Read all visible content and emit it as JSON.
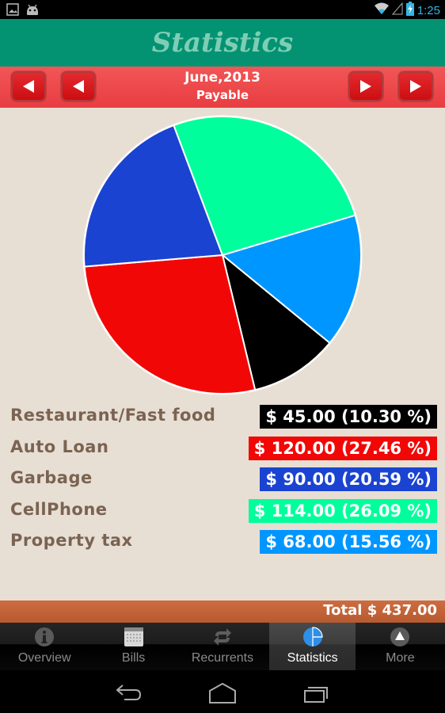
{
  "status_bar": {
    "time": "1:25",
    "icons": [
      "image-icon",
      "android-icon",
      "wifi-icon",
      "signal-icon",
      "battery-charging-icon"
    ]
  },
  "header": {
    "title": "Statistics"
  },
  "period_nav": {
    "month_label": "June,2013",
    "type_label": "Payable",
    "buttons": [
      "prev-year",
      "prev-month",
      "next-month",
      "next-year"
    ]
  },
  "colors": {
    "title_bar": "#039373",
    "nav_bar": "#ef4b4f",
    "total_bar": "#c4643a",
    "background": "#e8dfd4",
    "legend_text": "#7a6352",
    "active_tab_icon": "#2f8ee8"
  },
  "chart_data": {
    "type": "pie",
    "title": "",
    "start_angle_deg": -16.7,
    "direction": "clockwise",
    "slices": [
      {
        "label": "Property tax",
        "value": 68.0,
        "percent": 15.56,
        "color": "#0096ff"
      },
      {
        "label": "Restaurant/Fast food",
        "value": 45.0,
        "percent": 10.3,
        "color": "#000000"
      },
      {
        "label": "Auto Loan",
        "value": 120.0,
        "percent": 27.46,
        "color": "#f20707"
      },
      {
        "label": "Garbage",
        "value": 90.0,
        "percent": 20.59,
        "color": "#1a43d1"
      },
      {
        "label": "CellPhone",
        "value": 114.0,
        "percent": 26.09,
        "color": "#00ff9c"
      }
    ],
    "slice_border": "#ffffff"
  },
  "legend": [
    {
      "label": "Restaurant/Fast food",
      "value_text": "$ 45.00 (10.30 %)",
      "color": "#000000"
    },
    {
      "label": "Auto Loan",
      "value_text": "$ 120.00 (27.46 %)",
      "color": "#f20707"
    },
    {
      "label": "Garbage",
      "value_text": "$ 90.00 (20.59 %)",
      "color": "#1a43d1"
    },
    {
      "label": "CellPhone",
      "value_text": "$ 114.00 (26.09 %)",
      "color": "#00ff9c"
    },
    {
      "label": "Property tax",
      "value_text": "$ 68.00 (15.56 %)",
      "color": "#0096ff"
    }
  ],
  "total": {
    "text": "Total $ 437.00"
  },
  "tabs": [
    {
      "label": "Overview",
      "icon": "info-icon",
      "active": false
    },
    {
      "label": "Bills",
      "icon": "calendar-icon",
      "active": false
    },
    {
      "label": "Recurrents",
      "icon": "repeat-icon",
      "active": false
    },
    {
      "label": "Statistics",
      "icon": "pie-chart-icon",
      "active": true
    },
    {
      "label": "More",
      "icon": "more-icon",
      "active": false
    }
  ],
  "system_nav": [
    "back-icon",
    "home-icon",
    "recent-apps-icon"
  ]
}
